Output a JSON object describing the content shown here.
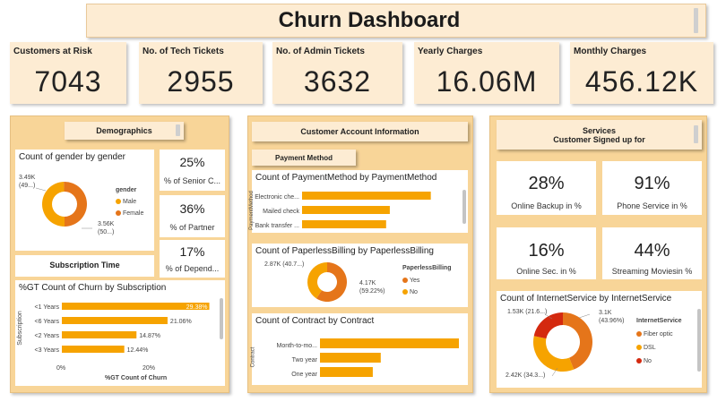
{
  "header": {
    "title": "Churn Dashboard"
  },
  "kpis": [
    {
      "label": "Customers at Risk",
      "value": "7043"
    },
    {
      "label": "No. of Tech Tickets",
      "value": "2955"
    },
    {
      "label": "No. of Admin Tickets",
      "value": "3632"
    },
    {
      "label": "Yearly Charges",
      "value": "16.06M"
    },
    {
      "label": "Monthly Charges",
      "value": "456.12K"
    }
  ],
  "demographics": {
    "title": "Demographics",
    "gender_chart": {
      "title": "Count of gender by gender",
      "legend_title": "gender",
      "legend": [
        "Male",
        "Female"
      ],
      "label_a": "3.49K",
      "label_a2": "(49...)",
      "label_b": "3.56K",
      "label_b2": "(50...)"
    },
    "stats": [
      {
        "value": "25%",
        "label": "% of Senior C..."
      },
      {
        "value": "36%",
        "label": "% of Partner"
      },
      {
        "value": "17%",
        "label": "% of Depend..."
      }
    ],
    "subscription_time_title": "Subscription Time",
    "subscription_chart": {
      "title": "%GT Count of Churn by Subscription",
      "ylabel": "Subscription",
      "xlabel": "%GT Count of Churn",
      "ticks": [
        "0%",
        "20%"
      ],
      "categories": [
        "<1 Years",
        "<6 Years",
        "<2 Years",
        "<3 Years"
      ],
      "value_labels": [
        "29.38%",
        "21.06%",
        "14.87%",
        "12.44%"
      ]
    }
  },
  "account": {
    "title": "Customer Account Information",
    "payment_method_tab": "Payment Method",
    "payment_chart": {
      "title": "Count of PaymentMethod by PaymentMethod",
      "ylabel": "PaymentMethod",
      "categories": [
        "Electronic che...",
        "Mailed check",
        "Bank transfer ..."
      ]
    },
    "paperless_chart": {
      "title": "Count of PaperlessBilling by PaperlessBilling",
      "legend_title": "PaperlessBilling",
      "legend": [
        "Yes",
        "No"
      ],
      "label_a": "2.87K (40.7...)",
      "label_b": "4.17K",
      "label_b2": "(59.22%)"
    },
    "contract_chart": {
      "title": "Count of Contract by Contract",
      "ylabel": "Contract",
      "categories": [
        "Month-to-mo...",
        "Two year",
        "One year"
      ]
    }
  },
  "services": {
    "title_line1": "Services",
    "title_line2": "Customer Signed up for",
    "stats": [
      {
        "value": "28%",
        "label": "Online Backup in %"
      },
      {
        "value": "91%",
        "label": "Phone Service in %"
      },
      {
        "value": "16%",
        "label": "Online Sec. in %"
      },
      {
        "value": "44%",
        "label": "Streaming Moviesin %"
      }
    ],
    "internet_chart": {
      "title": "Count of InternetService by InternetService",
      "legend_title": "InternetService",
      "legend": [
        "Fiber optic",
        "DSL",
        "No"
      ],
      "label_a": "1.53K (21.6...)",
      "label_b": "3.1K",
      "label_b2": "(43.96%)",
      "label_c": "2.42K (34.3...)"
    }
  },
  "colors": {
    "orange_dark": "#e5751a",
    "orange": "#f6a300",
    "red": "#d4290f",
    "panel": "#f8d598",
    "card": "#fdecd3"
  },
  "chart_data": [
    {
      "type": "pie",
      "title": "Count of gender by gender",
      "categories": [
        "Male",
        "Female"
      ],
      "values": [
        3490,
        3560
      ]
    },
    {
      "type": "bar",
      "title": "%GT Count of Churn by Subscription",
      "categories": [
        "<1 Years",
        "<6 Years",
        "<2 Years",
        "<3 Years"
      ],
      "values": [
        29.38,
        21.06,
        14.87,
        12.44
      ],
      "xlabel": "%GT Count of Churn",
      "ylabel": "Subscription",
      "xlim": [
        0,
        30
      ]
    },
    {
      "type": "bar",
      "title": "Count of PaymentMethod by PaymentMethod",
      "categories": [
        "Electronic che...",
        "Mailed check",
        "Bank transfer ..."
      ],
      "values": [
        2365,
        1612,
        1544
      ],
      "xlim": [
        0,
        2700
      ]
    },
    {
      "type": "pie",
      "title": "Count of PaperlessBilling by PaperlessBilling",
      "categories": [
        "Yes",
        "No"
      ],
      "values": [
        4170,
        2870
      ]
    },
    {
      "type": "bar",
      "title": "Count of Contract by Contract",
      "categories": [
        "Month-to-mo...",
        "Two year",
        "One year"
      ],
      "values": [
        3875,
        1695,
        1473
      ],
      "xlim": [
        0,
        4000
      ]
    },
    {
      "type": "pie",
      "title": "Count of InternetService by InternetService",
      "categories": [
        "Fiber optic",
        "DSL",
        "No"
      ],
      "values": [
        3100,
        2420,
        1530
      ]
    }
  ]
}
